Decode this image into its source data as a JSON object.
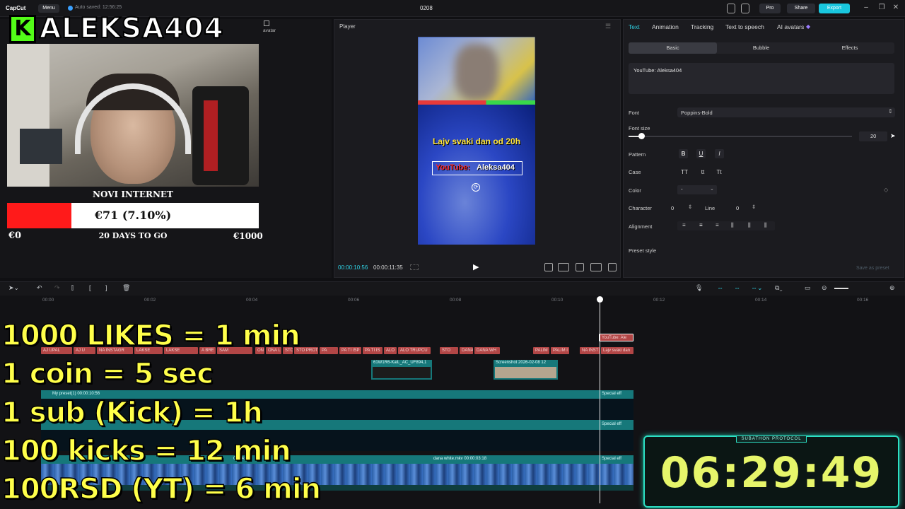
{
  "app": {
    "logo": "CapCut",
    "menu_label": "Menu",
    "autosave": "Auto saved: 12:56:25",
    "project_name": "0208",
    "pro_label": "Pro",
    "share_label": "Share",
    "export_label": "Export"
  },
  "media_panel": {
    "avatar_label": "avatar"
  },
  "overlay": {
    "streamer_name": "ALEKSA404",
    "kick_letter": "K",
    "goal": {
      "title": "NOVI INTERNET",
      "value_text": "€71 (7.10%)",
      "progress_fraction": 0.071,
      "min_label": "€0",
      "sub_label": "20 DAYS TO GO",
      "max_label": "€1000",
      "fill_color": "#ff1a1a"
    },
    "rules": [
      "1000 LIKES = 1 min",
      "1 coin = 5 sec",
      "1 sub (Kick) = 1h",
      "100 kicks = 12 min",
      "100RSD (YT) = 6 min"
    ],
    "timer": {
      "label": "SUBATHON PROTOCOL",
      "value": "06:29:49"
    }
  },
  "player": {
    "title": "Player",
    "current_time": "00:00:10:56",
    "total_time": "00:00:11:35",
    "preview_line1": "Lajv svaki dan od 20h",
    "preview_yt_label": "YouTube:",
    "preview_yt_name": "Aleksa404"
  },
  "props": {
    "tabs": [
      "Text",
      "Animation",
      "Tracking",
      "Text to speech",
      "AI avatars"
    ],
    "subtabs": [
      "Basic",
      "Bubble",
      "Effects"
    ],
    "text_value": "YouTube: Aleksa404",
    "font_label": "Font",
    "font_value": "Poppins-Bold",
    "font_size_label": "Font size",
    "font_size_value": "20",
    "pattern_label": "Pattern",
    "pattern_buttons": [
      "B",
      "U",
      "I"
    ],
    "case_label": "Case",
    "case_buttons": [
      "TT",
      "tt",
      "Tt"
    ],
    "color_label": "Color",
    "color_value": "-",
    "character_label": "Character",
    "character_value": "0",
    "line_label": "Line",
    "line_value": "0",
    "alignment_label": "Alignment",
    "preset_label": "Preset style",
    "save_preset": "Save as preset",
    "accent_color": "#2fd1e3"
  },
  "timeline": {
    "ruler": [
      "00:00",
      "00:02",
      "00:04",
      "00:06",
      "00:08",
      "00:10",
      "00:12",
      "00:14",
      "00:16"
    ],
    "text_clip_selected": "YouTube: Ale",
    "text_clips": [
      "AJ UPAL",
      "AJ U",
      "NA INSTAGR",
      "LAKSE",
      "LAKSE",
      "A BRE",
      "SAM",
      "ON",
      "ONA L",
      "STO",
      "STO PROT",
      "PA",
      "PA TI ISP",
      "PA TI IS",
      "ALO",
      "ALO TRUPCU",
      "STO",
      "DANA",
      "DANA WH",
      "PALIM",
      "PALIM I",
      "NA INST",
      "Lajv svaki dan"
    ],
    "clip_a": "61W1R6-KalL_AC_UF894,1",
    "clip_b": "Screenshot 2026-02-08 12",
    "track1_label": "My preset(1)  00:00:10:56",
    "special_effect": "Special eff",
    "track3_left": "00:04:51",
    "track3_mid": "dana white.mkv  00:00:03:18"
  }
}
